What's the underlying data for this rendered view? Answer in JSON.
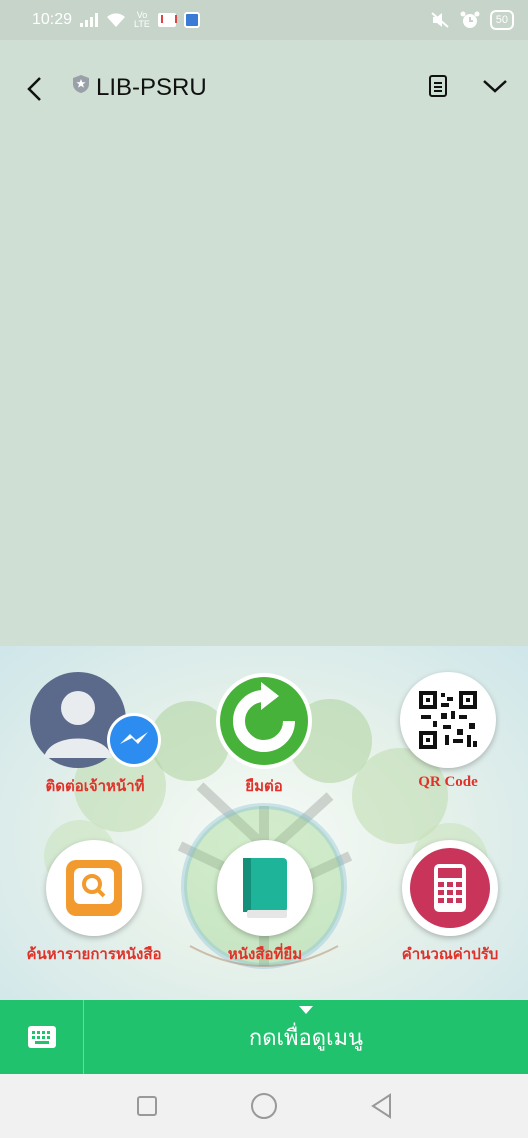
{
  "status": {
    "time": "10:29",
    "volte_top": "Vo",
    "volte_bottom": "LTE",
    "battery": "50"
  },
  "header": {
    "title": "LIB-PSRU"
  },
  "menu": {
    "items": [
      {
        "label": "ติดต่อเจ้าหน้าที่"
      },
      {
        "label": "ยืมต่อ"
      },
      {
        "label": "QR Code"
      },
      {
        "label": "ค้นหารายการหนังสือ"
      },
      {
        "label": "หนังสือที่ยืม"
      },
      {
        "label": "คำนวณค่าปรับ"
      }
    ]
  },
  "menu_bar": {
    "label": "กดเพื่อดูเมนู"
  },
  "colors": {
    "menu_bar": "#21c26e",
    "label_red": "#e0322a",
    "chat_bg": "#cfdfd4"
  }
}
